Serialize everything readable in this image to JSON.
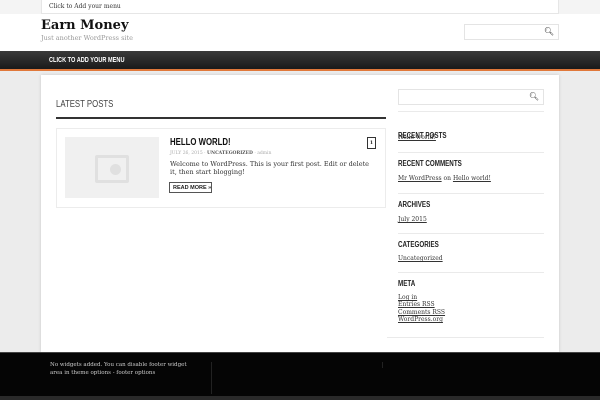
{
  "topbar": {
    "menu_link": "Click to Add your menu"
  },
  "header": {
    "site_title": "Earn Money",
    "tagline": "Just another WordPress site",
    "search_icon": "search-icon"
  },
  "nav": {
    "menu_label": "CLICK TO ADD YOUR MENU"
  },
  "main": {
    "section_title": "LATEST POSTS",
    "post": {
      "title": "HELLO WORLD!",
      "date": "JULY 26, 2015",
      "category": "UNCATEGORIZED",
      "author": "admin",
      "excerpt": "Welcome to WordPress. This is your first post. Edit or delete it, then start blogging!",
      "read_more": "READ MORE »",
      "comment_count": "1"
    }
  },
  "sidebar": {
    "recent_posts": {
      "title": "RECENT POSTS",
      "items": [
        "Hello world!"
      ]
    },
    "recent_comments": {
      "title": "RECENT COMMENTS",
      "author": "Mr WordPress",
      "on": "on",
      "post": "Hello world!"
    },
    "archives": {
      "title": "ARCHIVES",
      "items": [
        "July 2015"
      ]
    },
    "categories": {
      "title": "CATEGORIES",
      "items": [
        "Uncategorized"
      ]
    },
    "meta": {
      "title": "META",
      "items": [
        "Log in",
        "Entries RSS",
        "Comments RSS",
        "WordPress.org"
      ]
    }
  },
  "footer": {
    "text": "No widgets added. You can disable footer widget area in theme options - footer options"
  }
}
